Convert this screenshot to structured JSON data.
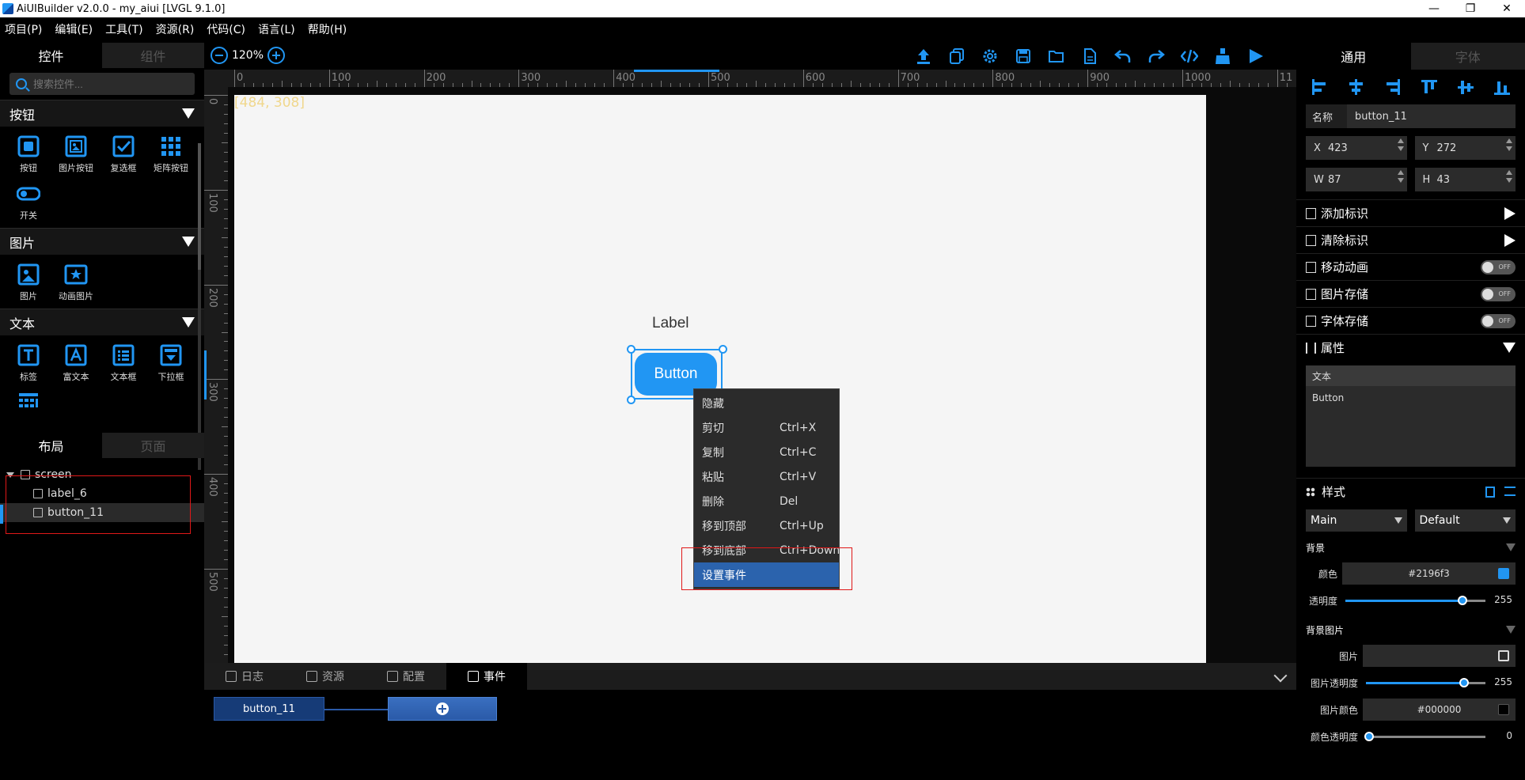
{
  "window": {
    "title": "AiUIBuilder v2.0.0 - my_aiui [LVGL 9.1.0]",
    "minimize": "—",
    "restore": "❐",
    "close": "✕"
  },
  "menu": [
    "项目(P)",
    "编辑(E)",
    "工具(T)",
    "资源(R)",
    "代码(C)",
    "语言(L)",
    "帮助(H)"
  ],
  "left_panel": {
    "tabs": [
      "控件",
      "组件"
    ],
    "search_placeholder": "搜索控件...",
    "categories": [
      {
        "name": "按钮",
        "items": [
          "按钮",
          "图片按钮",
          "复选框",
          "矩阵按钮",
          "开关"
        ]
      },
      {
        "name": "图片",
        "items": [
          "图片",
          "动画图片"
        ]
      },
      {
        "name": "文本",
        "items": [
          "标签",
          "富文本",
          "文本框",
          "下拉框"
        ]
      }
    ],
    "layout_tabs": [
      "布局",
      "页面"
    ],
    "tree": [
      "screen",
      "label_6",
      "button_11"
    ]
  },
  "toolbar": {
    "zoom": "120%",
    "tool_icons": [
      "upload-icon",
      "copy-icon",
      "settings-icon",
      "save-icon",
      "open-folder-icon",
      "new-file-icon",
      "undo-icon",
      "redo-icon",
      "code-icon",
      "clean-icon",
      "run-icon"
    ]
  },
  "rulers": {
    "top_labels": [
      "0",
      "100",
      "200",
      "300",
      "400",
      "500",
      "600",
      "700",
      "800",
      "900",
      "1000",
      "11"
    ],
    "left_labels": [
      "0",
      "100",
      "200",
      "300",
      "400",
      "500"
    ]
  },
  "canvas": {
    "coord": "[484, 308]",
    "label_text": "Label",
    "button_text": "Button"
  },
  "context_menu": [
    {
      "label": "隐藏",
      "shortcut": ""
    },
    {
      "label": "剪切",
      "shortcut": "Ctrl+X"
    },
    {
      "label": "复制",
      "shortcut": "Ctrl+C"
    },
    {
      "label": "粘贴",
      "shortcut": "Ctrl+V"
    },
    {
      "label": "删除",
      "shortcut": "Del"
    },
    {
      "label": "移到顶部",
      "shortcut": "Ctrl+Up"
    },
    {
      "label": "移到底部",
      "shortcut": "Ctrl+Down"
    },
    {
      "label": "设置事件",
      "shortcut": ""
    }
  ],
  "bottom": {
    "tabs": [
      "日志",
      "资源",
      "配置",
      "事件"
    ],
    "event_node": "button_11"
  },
  "right_panel": {
    "tabs": [
      "通用",
      "字体"
    ],
    "name_label": "名称",
    "name_value": "button_11",
    "x_label": "X",
    "x": "423",
    "y_label": "Y",
    "y": "272",
    "w_label": "W",
    "w": "87",
    "h_label": "H",
    "h": "43",
    "sections": [
      "添加标识",
      "清除标识",
      "移动动画",
      "图片存储",
      "字体存储",
      "属性"
    ],
    "toggle_text": "OFF",
    "text_header": "文本",
    "text_value": "Button",
    "style_title": "样式",
    "style_part": "Main",
    "style_state": "Default",
    "bg_title": "背景",
    "color_label": "颜色",
    "color_value": "#2196f3",
    "opacity_label": "透明度",
    "opacity_value": "255",
    "opacity_fraction": 1.0,
    "bgimg_title": "背景图片",
    "img_label": "图片",
    "img_opacity_label": "图片透明度",
    "img_opacity_value": "255",
    "img_color_label": "图片颜色",
    "img_color_value": "#000000",
    "color_opacity_label": "颜色透明度",
    "color_opacity_value": "0",
    "accent": "#2196f3"
  }
}
